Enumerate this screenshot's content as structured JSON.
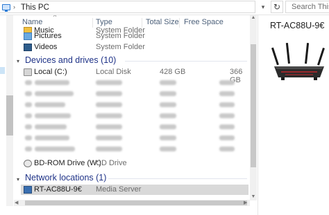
{
  "address": {
    "location": "This PC",
    "search_placeholder": "Search This PC"
  },
  "columns": {
    "name": "Name",
    "type": "Type",
    "total_size": "Total Size",
    "free_space": "Free Space"
  },
  "folders": [
    {
      "name": "Music",
      "type": "System Folder",
      "icon": "music-folder-icon"
    },
    {
      "name": "Pictures",
      "type": "System Folder",
      "icon": "pictures-folder-icon"
    },
    {
      "name": "Videos",
      "type": "System Folder",
      "icon": "videos-folder-icon"
    }
  ],
  "devices_group": {
    "label": "Devices and drives (10)"
  },
  "drives": [
    {
      "name": "Local (C:)",
      "type": "Local Disk",
      "total": "428 GB",
      "free": "366 GB"
    },
    {
      "name": "BD-ROM Drive (W:)",
      "type": "CD Drive",
      "total": "",
      "free": ""
    }
  ],
  "network_group": {
    "label": "Network locations (1)"
  },
  "network": [
    {
      "name": "RT-AC88U-9€",
      "type": "Media Server"
    }
  ],
  "details": {
    "title": "RT-AC88U-9€"
  },
  "colors": {
    "group_header": "#1e3287",
    "selection": "#d9d9d9",
    "column_header": "#4c607a"
  }
}
